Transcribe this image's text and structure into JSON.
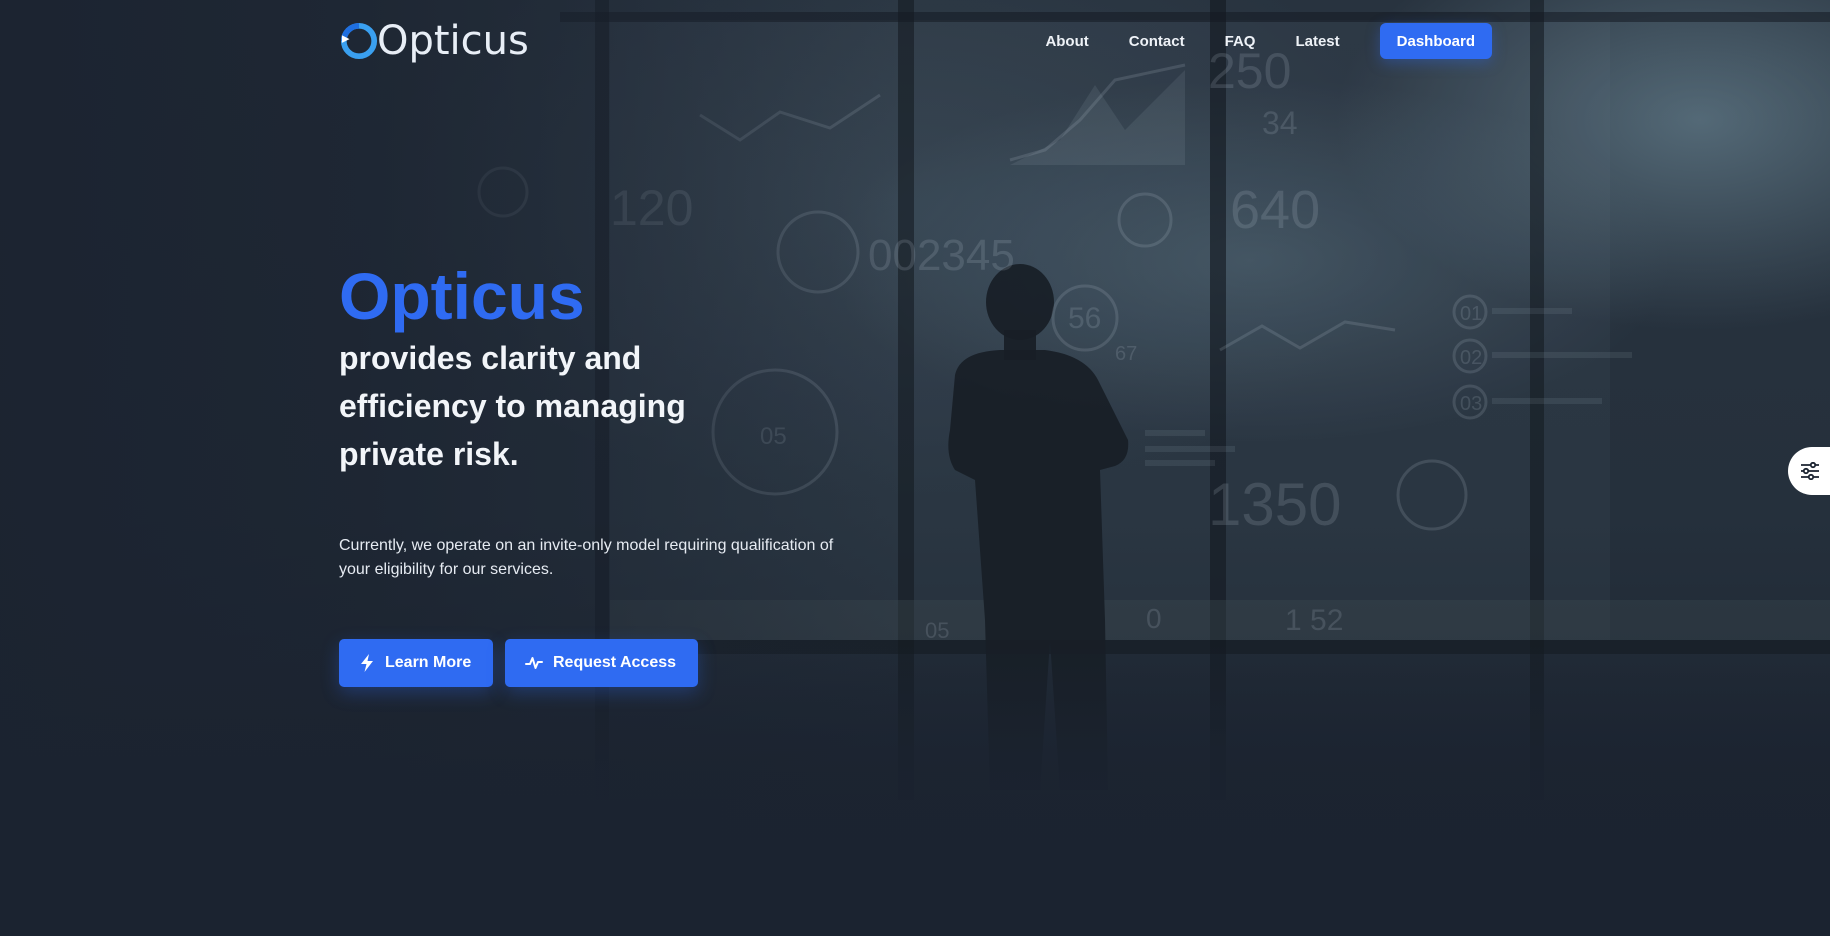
{
  "brand": {
    "name": "Opticus",
    "accent_color": "#2f6bf2"
  },
  "nav": {
    "links": [
      "About",
      "Contact",
      "FAQ",
      "Latest"
    ],
    "dashboard_label": "Dashboard"
  },
  "hero": {
    "title": "Opticus",
    "subtitle": "provides clarity and efficiency to managing private risk.",
    "description": "Currently, we operate on an invite-only model requiring qualification of your eligibility for our services.",
    "learn_more_label": "Learn More",
    "request_access_label": "Request Access"
  },
  "background_overlay": {
    "numbers": [
      "250",
      "34",
      "640",
      "002345",
      "120",
      "56",
      "67",
      "05",
      "1350",
      "01",
      "02",
      "03",
      "0",
      "1 52",
      "05"
    ]
  },
  "icons": {
    "learn_more": "lightning-icon",
    "request_access": "pulse-icon",
    "settings_tab": "sliders-icon"
  }
}
